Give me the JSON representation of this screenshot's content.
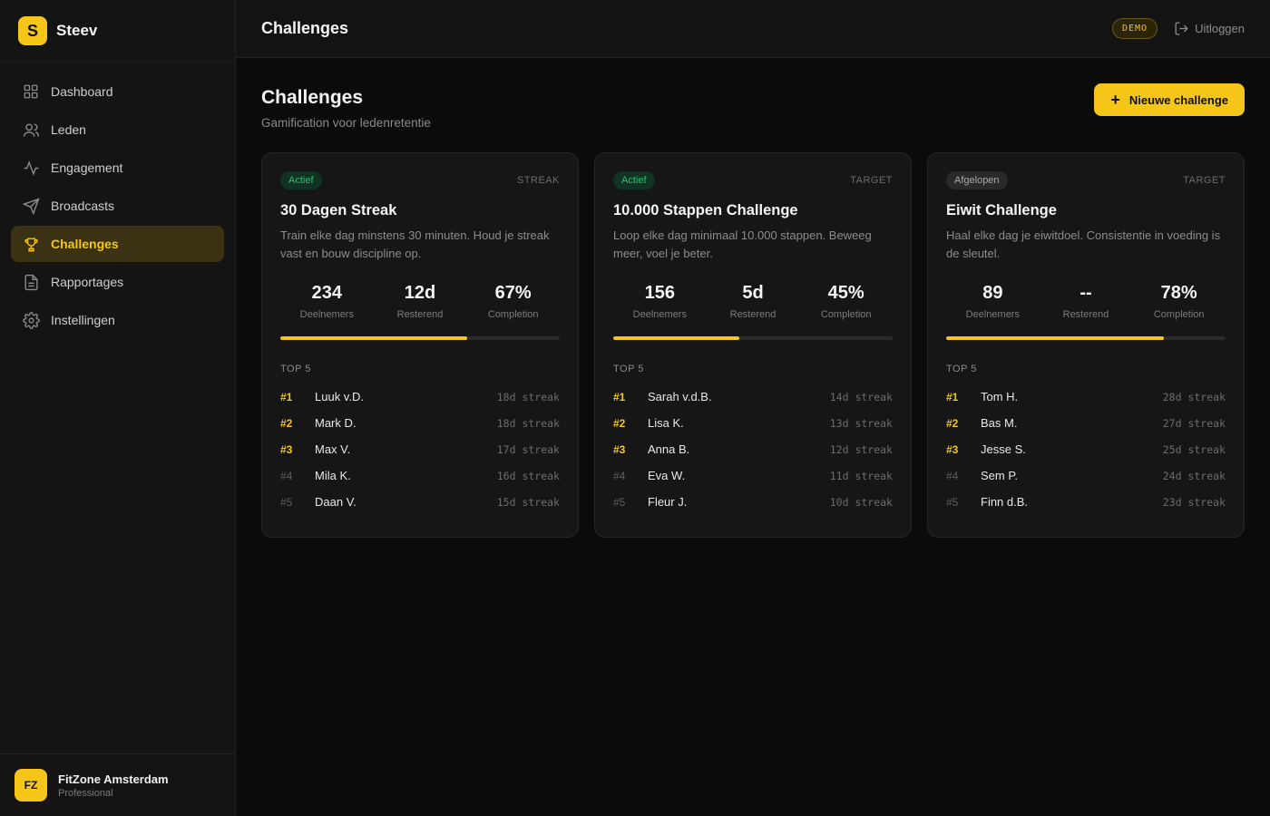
{
  "brand": {
    "logo_letter": "S",
    "name": "Steev"
  },
  "sidebar": {
    "items": [
      {
        "label": "Dashboard",
        "icon": "grid-icon"
      },
      {
        "label": "Leden",
        "icon": "users-icon"
      },
      {
        "label": "Engagement",
        "icon": "activity-icon"
      },
      {
        "label": "Broadcasts",
        "icon": "send-icon"
      },
      {
        "label": "Challenges",
        "icon": "trophy-icon",
        "active": true
      },
      {
        "label": "Rapportages",
        "icon": "file-text-icon"
      },
      {
        "label": "Instellingen",
        "icon": "gear-icon"
      }
    ]
  },
  "org": {
    "initials": "FZ",
    "name": "FitZone Amsterdam",
    "plan": "Professional"
  },
  "topbar": {
    "title": "Challenges",
    "demo_label": "DEMO",
    "logout_label": "Uitloggen"
  },
  "page": {
    "title": "Challenges",
    "subtitle": "Gamification voor ledenretentie",
    "new_button_label": "Nieuwe challenge"
  },
  "colors": {
    "accent": "#f5c518",
    "active_status": "#2fbf71",
    "background": "#0b0b0b",
    "card": "#161616"
  },
  "challenges": [
    {
      "status": "Actief",
      "status_kind": "actief",
      "type": "STREAK",
      "title": "30 Dagen Streak",
      "description": "Train elke dag minstens 30 minuten. Houd je streak vast en bouw discipline op.",
      "stats": [
        {
          "value": "234",
          "label": "Deelnemers"
        },
        {
          "value": "12d",
          "label": "Resterend"
        },
        {
          "value": "67%",
          "label": "Completion"
        }
      ],
      "progress": 0.67,
      "top_label": "TOP 5",
      "leaderboard": [
        {
          "rank": "#1",
          "name": "Luuk v.D.",
          "streak": "18d streak"
        },
        {
          "rank": "#2",
          "name": "Mark D.",
          "streak": "18d streak"
        },
        {
          "rank": "#3",
          "name": "Max V.",
          "streak": "17d streak"
        },
        {
          "rank": "#4",
          "name": "Mila K.",
          "streak": "16d streak"
        },
        {
          "rank": "#5",
          "name": "Daan V.",
          "streak": "15d streak"
        }
      ]
    },
    {
      "status": "Actief",
      "status_kind": "actief",
      "type": "TARGET",
      "title": "10.000 Stappen Challenge",
      "description": "Loop elke dag minimaal 10.000 stappen. Beweeg meer, voel je beter.",
      "stats": [
        {
          "value": "156",
          "label": "Deelnemers"
        },
        {
          "value": "5d",
          "label": "Resterend"
        },
        {
          "value": "45%",
          "label": "Completion"
        }
      ],
      "progress": 0.45,
      "top_label": "TOP 5",
      "leaderboard": [
        {
          "rank": "#1",
          "name": "Sarah v.d.B.",
          "streak": "14d streak"
        },
        {
          "rank": "#2",
          "name": "Lisa K.",
          "streak": "13d streak"
        },
        {
          "rank": "#3",
          "name": "Anna B.",
          "streak": "12d streak"
        },
        {
          "rank": "#4",
          "name": "Eva W.",
          "streak": "11d streak"
        },
        {
          "rank": "#5",
          "name": "Fleur J.",
          "streak": "10d streak"
        }
      ]
    },
    {
      "status": "Afgelopen",
      "status_kind": "afgelopen",
      "type": "TARGET",
      "title": "Eiwit Challenge",
      "description": "Haal elke dag je eiwitdoel. Consistentie in voeding is de sleutel.",
      "stats": [
        {
          "value": "89",
          "label": "Deelnemers"
        },
        {
          "value": "--",
          "label": "Resterend"
        },
        {
          "value": "78%",
          "label": "Completion"
        }
      ],
      "progress": 0.78,
      "top_label": "TOP 5",
      "leaderboard": [
        {
          "rank": "#1",
          "name": "Tom H.",
          "streak": "28d streak"
        },
        {
          "rank": "#2",
          "name": "Bas M.",
          "streak": "27d streak"
        },
        {
          "rank": "#3",
          "name": "Jesse S.",
          "streak": "25d streak"
        },
        {
          "rank": "#4",
          "name": "Sem P.",
          "streak": "24d streak"
        },
        {
          "rank": "#5",
          "name": "Finn d.B.",
          "streak": "23d streak"
        }
      ]
    }
  ]
}
